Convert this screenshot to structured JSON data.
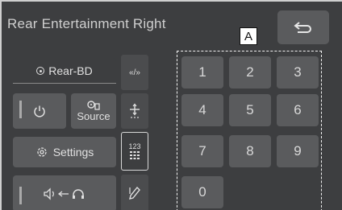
{
  "header": {
    "title": "Rear Entertainment Right",
    "back_icon": "return-arrow-icon"
  },
  "callout": {
    "label": "A"
  },
  "left_panel": {
    "disc_label": "Rear-BD",
    "power_icon": "power-icon",
    "source_label": "Source",
    "settings_label": "Settings",
    "audio_switch_icon": "speaker-to-headphones-icon"
  },
  "side_tabs": {
    "skip_label": "«/»",
    "cursor_icon": "cursor-move-icon",
    "numpad_label": "123",
    "pen_icon": "pen-icon"
  },
  "keypad": {
    "keys": [
      "1",
      "2",
      "3",
      "4",
      "5",
      "6",
      "7",
      "8",
      "9",
      "0"
    ]
  }
}
